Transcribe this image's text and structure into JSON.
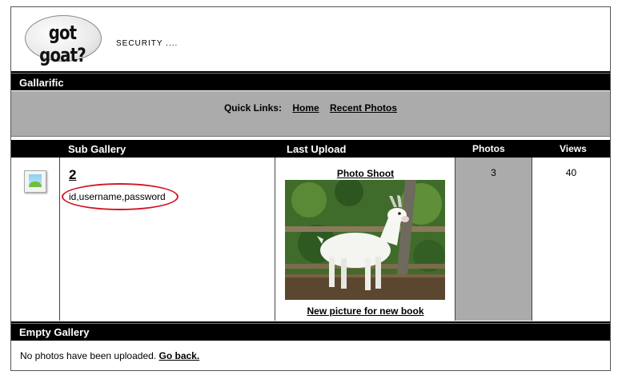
{
  "header": {
    "logo_text": "got goat?",
    "tagline": "SECURITY ...."
  },
  "gallery": {
    "title": "Gallarific"
  },
  "quick_links": {
    "label": "Quick Links:",
    "links": [
      "Home",
      "Recent Photos"
    ]
  },
  "table": {
    "columns": [
      "Sub Gallery",
      "Last Upload",
      "Photos",
      "Views"
    ],
    "row": {
      "sub_gallery_number": "2",
      "sub_gallery_description": "id,username,password",
      "last_upload_title": "Photo Shoot",
      "last_upload_caption": "New picture for new book",
      "photos": "3",
      "views": "40"
    }
  },
  "empty_gallery": {
    "title": "Empty Gallery",
    "message": "No photos have been uploaded.",
    "link": "Go back."
  },
  "colors": {
    "band": "#000000",
    "panel_gray": "#ababab",
    "highlight": "#d3182a"
  }
}
